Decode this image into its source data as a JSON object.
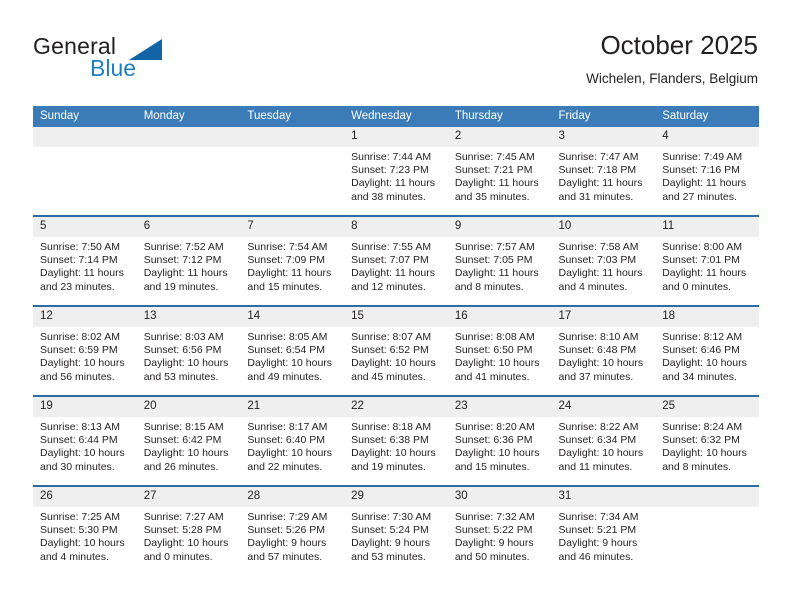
{
  "brand": {
    "name_part1": "General",
    "name_part2": "Blue",
    "triangle_color": "#1264a5",
    "blue_color": "#1f7fc4"
  },
  "header": {
    "title": "October 2025",
    "location": "Wichelen, Flanders, Belgium"
  },
  "theme": {
    "header_bg": "#3b7cb8",
    "row_border": "#2e6da4",
    "daynum_bg": "#efefef",
    "text": "#231f20"
  },
  "calendar": {
    "weekday_headers": [
      "Sunday",
      "Monday",
      "Tuesday",
      "Wednesday",
      "Thursday",
      "Friday",
      "Saturday"
    ],
    "weeks": [
      [
        {
          "day": "",
          "info": ""
        },
        {
          "day": "",
          "info": ""
        },
        {
          "day": "",
          "info": ""
        },
        {
          "day": "1",
          "info": "Sunrise: 7:44 AM\nSunset: 7:23 PM\nDaylight: 11 hours\nand 38 minutes."
        },
        {
          "day": "2",
          "info": "Sunrise: 7:45 AM\nSunset: 7:21 PM\nDaylight: 11 hours\nand 35 minutes."
        },
        {
          "day": "3",
          "info": "Sunrise: 7:47 AM\nSunset: 7:18 PM\nDaylight: 11 hours\nand 31 minutes."
        },
        {
          "day": "4",
          "info": "Sunrise: 7:49 AM\nSunset: 7:16 PM\nDaylight: 11 hours\nand 27 minutes."
        }
      ],
      [
        {
          "day": "5",
          "info": "Sunrise: 7:50 AM\nSunset: 7:14 PM\nDaylight: 11 hours\nand 23 minutes."
        },
        {
          "day": "6",
          "info": "Sunrise: 7:52 AM\nSunset: 7:12 PM\nDaylight: 11 hours\nand 19 minutes."
        },
        {
          "day": "7",
          "info": "Sunrise: 7:54 AM\nSunset: 7:09 PM\nDaylight: 11 hours\nand 15 minutes."
        },
        {
          "day": "8",
          "info": "Sunrise: 7:55 AM\nSunset: 7:07 PM\nDaylight: 11 hours\nand 12 minutes."
        },
        {
          "day": "9",
          "info": "Sunrise: 7:57 AM\nSunset: 7:05 PM\nDaylight: 11 hours\nand 8 minutes."
        },
        {
          "day": "10",
          "info": "Sunrise: 7:58 AM\nSunset: 7:03 PM\nDaylight: 11 hours\nand 4 minutes."
        },
        {
          "day": "11",
          "info": "Sunrise: 8:00 AM\nSunset: 7:01 PM\nDaylight: 11 hours\nand 0 minutes."
        }
      ],
      [
        {
          "day": "12",
          "info": "Sunrise: 8:02 AM\nSunset: 6:59 PM\nDaylight: 10 hours\nand 56 minutes."
        },
        {
          "day": "13",
          "info": "Sunrise: 8:03 AM\nSunset: 6:56 PM\nDaylight: 10 hours\nand 53 minutes."
        },
        {
          "day": "14",
          "info": "Sunrise: 8:05 AM\nSunset: 6:54 PM\nDaylight: 10 hours\nand 49 minutes."
        },
        {
          "day": "15",
          "info": "Sunrise: 8:07 AM\nSunset: 6:52 PM\nDaylight: 10 hours\nand 45 minutes."
        },
        {
          "day": "16",
          "info": "Sunrise: 8:08 AM\nSunset: 6:50 PM\nDaylight: 10 hours\nand 41 minutes."
        },
        {
          "day": "17",
          "info": "Sunrise: 8:10 AM\nSunset: 6:48 PM\nDaylight: 10 hours\nand 37 minutes."
        },
        {
          "day": "18",
          "info": "Sunrise: 8:12 AM\nSunset: 6:46 PM\nDaylight: 10 hours\nand 34 minutes."
        }
      ],
      [
        {
          "day": "19",
          "info": "Sunrise: 8:13 AM\nSunset: 6:44 PM\nDaylight: 10 hours\nand 30 minutes."
        },
        {
          "day": "20",
          "info": "Sunrise: 8:15 AM\nSunset: 6:42 PM\nDaylight: 10 hours\nand 26 minutes."
        },
        {
          "day": "21",
          "info": "Sunrise: 8:17 AM\nSunset: 6:40 PM\nDaylight: 10 hours\nand 22 minutes."
        },
        {
          "day": "22",
          "info": "Sunrise: 8:18 AM\nSunset: 6:38 PM\nDaylight: 10 hours\nand 19 minutes."
        },
        {
          "day": "23",
          "info": "Sunrise: 8:20 AM\nSunset: 6:36 PM\nDaylight: 10 hours\nand 15 minutes."
        },
        {
          "day": "24",
          "info": "Sunrise: 8:22 AM\nSunset: 6:34 PM\nDaylight: 10 hours\nand 11 minutes."
        },
        {
          "day": "25",
          "info": "Sunrise: 8:24 AM\nSunset: 6:32 PM\nDaylight: 10 hours\nand 8 minutes."
        }
      ],
      [
        {
          "day": "26",
          "info": "Sunrise: 7:25 AM\nSunset: 5:30 PM\nDaylight: 10 hours\nand 4 minutes."
        },
        {
          "day": "27",
          "info": "Sunrise: 7:27 AM\nSunset: 5:28 PM\nDaylight: 10 hours\nand 0 minutes."
        },
        {
          "day": "28",
          "info": "Sunrise: 7:29 AM\nSunset: 5:26 PM\nDaylight: 9 hours\nand 57 minutes."
        },
        {
          "day": "29",
          "info": "Sunrise: 7:30 AM\nSunset: 5:24 PM\nDaylight: 9 hours\nand 53 minutes."
        },
        {
          "day": "30",
          "info": "Sunrise: 7:32 AM\nSunset: 5:22 PM\nDaylight: 9 hours\nand 50 minutes."
        },
        {
          "day": "31",
          "info": "Sunrise: 7:34 AM\nSunset: 5:21 PM\nDaylight: 9 hours\nand 46 minutes."
        },
        {
          "day": "",
          "info": ""
        }
      ]
    ]
  }
}
